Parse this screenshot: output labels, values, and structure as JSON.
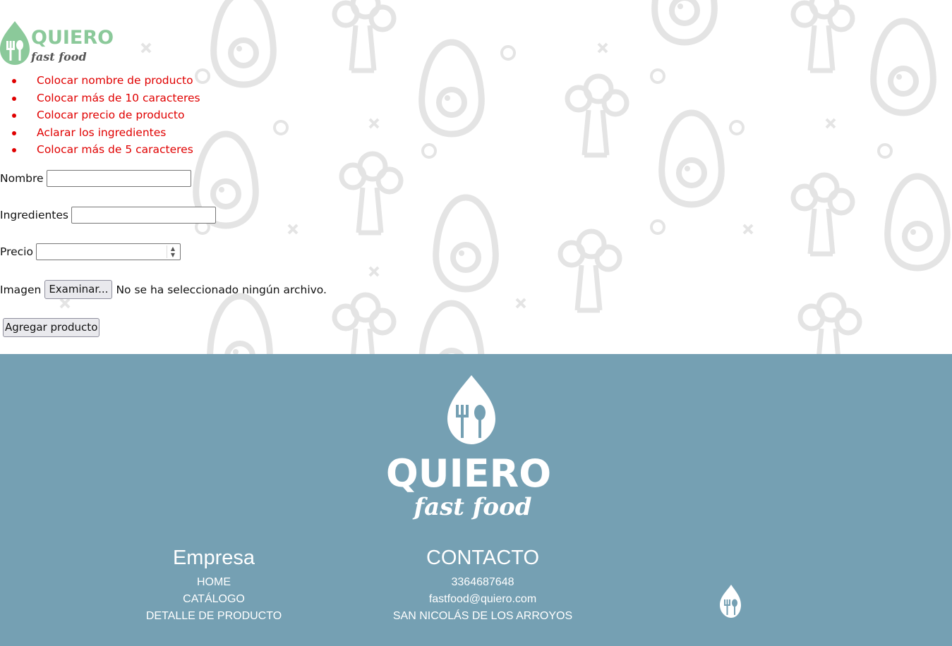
{
  "brand": {
    "name": "QUIERO",
    "tagline": "fast food"
  },
  "errors": [
    "Colocar nombre de producto",
    "Colocar más de 10 caracteres",
    "Colocar precio de producto",
    "Aclarar los ingredientes",
    "Colocar más de 5 caracteres"
  ],
  "form": {
    "nombre_label": "Nombre",
    "nombre_value": "",
    "ingredientes_label": "Ingredientes",
    "ingredientes_value": "",
    "precio_label": "Precio",
    "precio_value": "",
    "imagen_label": "Imagen",
    "file_button": "Examinar...",
    "file_status": "No se ha seleccionado ningún archivo.",
    "submit": "Agregar producto"
  },
  "footer": {
    "empresa": {
      "title": "Empresa",
      "links": [
        "HOME",
        "CATÁLOGO",
        "DETALLE DE PRODUCTO"
      ]
    },
    "contacto": {
      "title": "CONTACTO",
      "items": [
        "3364687648",
        "fastfood@quiero.com",
        "SAN NICOLÁS DE LOS ARROYOS"
      ]
    }
  },
  "colors": {
    "error": "#e00000",
    "footer_bg": "#75a0b3",
    "logo_green": "#8bc99a",
    "pattern": "#e6e6e6"
  },
  "icons": [
    "avocado-icon",
    "broccoli-icon",
    "x-mark-icon",
    "circle-icon",
    "fork-spoon-drop-icon"
  ]
}
